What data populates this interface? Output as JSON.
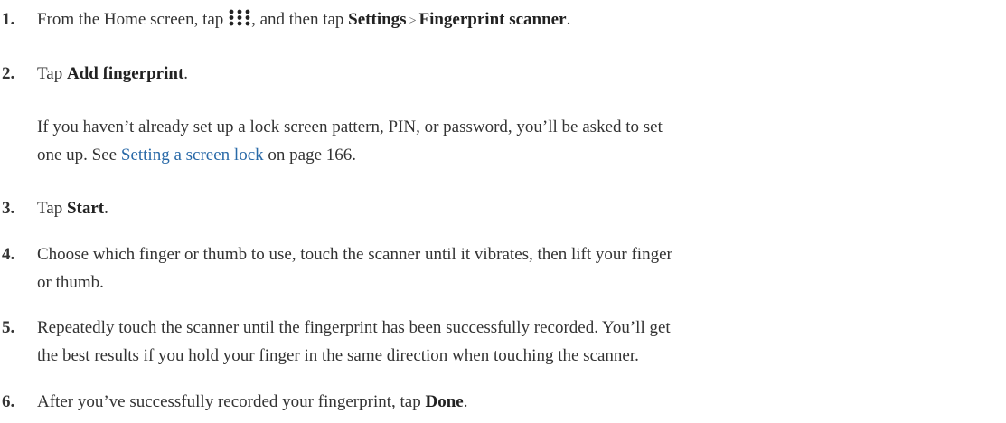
{
  "steps": [
    {
      "number": "1.",
      "before_icon": "From the Home screen, tap ",
      "icon": "apps-grid-icon",
      "after_icon": ", and then tap ",
      "bold1": "Settings",
      "separator": ">",
      "bold2": "Fingerprint scanner",
      "end": "."
    },
    {
      "number": "2.",
      "lead": "Tap ",
      "bold": "Add fingerprint",
      "end": ".",
      "note_line1": "If you haven’t already set up a lock screen pattern, PIN, or password, you’ll be asked to set",
      "note_line2_before": "one up. See ",
      "note_link": "Setting a screen lock",
      "note_line2_after": " on page 166."
    },
    {
      "number": "3.",
      "lead": "Tap ",
      "bold": "Start",
      "end": "."
    },
    {
      "number": "4.",
      "line1": "Choose which finger or thumb to use, touch the scanner until it vibrates, then lift your finger",
      "line2": "or thumb."
    },
    {
      "number": "5.",
      "line1": "Repeatedly touch the scanner until the fingerprint has been successfully recorded. You’ll get",
      "line2": "the best results if you hold your finger in the same direction when touching the scanner."
    },
    {
      "number": "6.",
      "lead": "After you’ve successfully recorded your fingerprint, tap ",
      "bold": "Done",
      "end": "."
    }
  ]
}
